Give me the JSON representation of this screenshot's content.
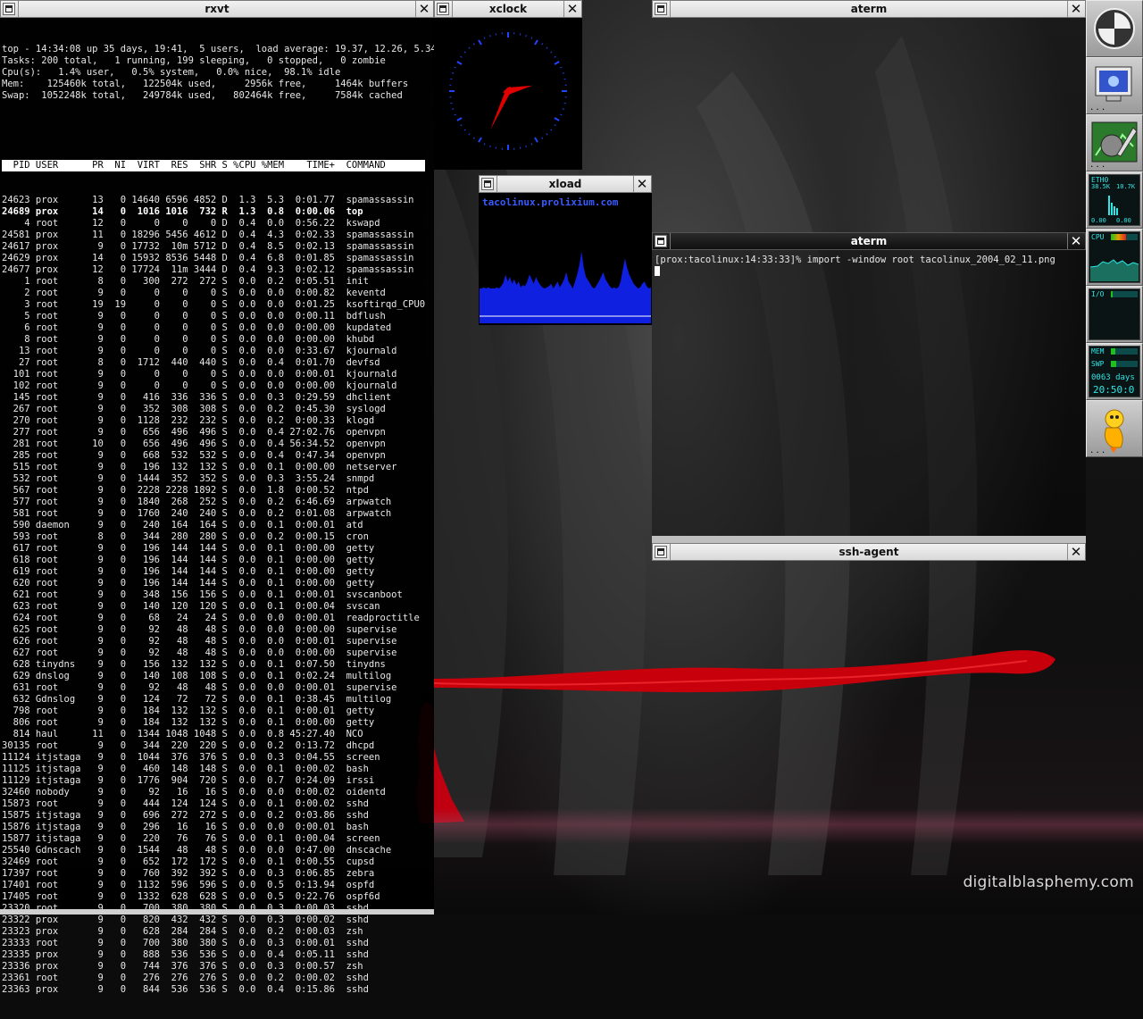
{
  "wallpaper": {
    "credit": "digitalblasphemy.com"
  },
  "rxvt": {
    "title": "rxvt",
    "summary": [
      "top - 14:34:08 up 35 days, 19:41,  5 users,  load average: 19.37, 12.26, 5.34",
      "Tasks: 200 total,   1 running, 199 sleeping,   0 stopped,   0 zombie",
      "Cpu(s):   1.4% user,   0.5% system,   0.0% nice,  98.1% idle",
      "Mem:    125460k total,   122504k used,     2956k free,     1464k buffers",
      "Swap:  1052248k total,   249784k used,   802464k free,     7584k cached"
    ],
    "columns": "  PID USER      PR  NI  VIRT  RES  SHR S %CPU %MEM    TIME+  COMMAND",
    "processes": [
      [
        "24623",
        "prox",
        "13",
        "0",
        "14640",
        "6596",
        "4852",
        "D",
        "1.3",
        "5.3",
        "0:01.77",
        "spamassassin"
      ],
      [
        "24689",
        "prox",
        "14",
        "0",
        "1016",
        "1016",
        "732",
        "R",
        "1.3",
        "0.8",
        "0:00.06",
        "top"
      ],
      [
        "4",
        "root",
        "12",
        "0",
        "0",
        "0",
        "0",
        "D",
        "0.4",
        "0.0",
        "0:56.22",
        "kswapd"
      ],
      [
        "24581",
        "prox",
        "11",
        "0",
        "18296",
        "5456",
        "4612",
        "D",
        "0.4",
        "4.3",
        "0:02.33",
        "spamassassin"
      ],
      [
        "24617",
        "prox",
        "9",
        "0",
        "17732",
        "10m",
        "5712",
        "D",
        "0.4",
        "8.5",
        "0:02.13",
        "spamassassin"
      ],
      [
        "24629",
        "prox",
        "14",
        "0",
        "15932",
        "8536",
        "5448",
        "D",
        "0.4",
        "6.8",
        "0:01.85",
        "spamassassin"
      ],
      [
        "24677",
        "prox",
        "12",
        "0",
        "17724",
        "11m",
        "3444",
        "D",
        "0.4",
        "9.3",
        "0:02.12",
        "spamassassin"
      ],
      [
        "1",
        "root",
        "8",
        "0",
        "300",
        "272",
        "272",
        "S",
        "0.0",
        "0.2",
        "0:05.51",
        "init"
      ],
      [
        "2",
        "root",
        "9",
        "0",
        "0",
        "0",
        "0",
        "S",
        "0.0",
        "0.0",
        "0:00.82",
        "keventd"
      ],
      [
        "3",
        "root",
        "19",
        "19",
        "0",
        "0",
        "0",
        "S",
        "0.0",
        "0.0",
        "0:01.25",
        "ksoftirqd_CPU0"
      ],
      [
        "5",
        "root",
        "9",
        "0",
        "0",
        "0",
        "0",
        "S",
        "0.0",
        "0.0",
        "0:00.11",
        "bdflush"
      ],
      [
        "6",
        "root",
        "9",
        "0",
        "0",
        "0",
        "0",
        "S",
        "0.0",
        "0.0",
        "0:00.00",
        "kupdated"
      ],
      [
        "8",
        "root",
        "9",
        "0",
        "0",
        "0",
        "0",
        "S",
        "0.0",
        "0.0",
        "0:00.00",
        "khubd"
      ],
      [
        "13",
        "root",
        "9",
        "0",
        "0",
        "0",
        "0",
        "S",
        "0.0",
        "0.0",
        "0:33.67",
        "kjournald"
      ],
      [
        "27",
        "root",
        "8",
        "0",
        "1712",
        "440",
        "440",
        "S",
        "0.0",
        "0.4",
        "0:01.70",
        "devfsd"
      ],
      [
        "101",
        "root",
        "9",
        "0",
        "0",
        "0",
        "0",
        "S",
        "0.0",
        "0.0",
        "0:00.01",
        "kjournald"
      ],
      [
        "102",
        "root",
        "9",
        "0",
        "0",
        "0",
        "0",
        "S",
        "0.0",
        "0.0",
        "0:00.00",
        "kjournald"
      ],
      [
        "145",
        "root",
        "9",
        "0",
        "416",
        "336",
        "336",
        "S",
        "0.0",
        "0.3",
        "0:29.59",
        "dhclient"
      ],
      [
        "267",
        "root",
        "9",
        "0",
        "352",
        "308",
        "308",
        "S",
        "0.0",
        "0.2",
        "0:45.30",
        "syslogd"
      ],
      [
        "270",
        "root",
        "9",
        "0",
        "1128",
        "232",
        "232",
        "S",
        "0.0",
        "0.2",
        "0:00.33",
        "klogd"
      ],
      [
        "277",
        "root",
        "9",
        "0",
        "656",
        "496",
        "496",
        "S",
        "0.0",
        "0.4",
        "27:02.76",
        "openvpn"
      ],
      [
        "281",
        "root",
        "10",
        "0",
        "656",
        "496",
        "496",
        "S",
        "0.0",
        "0.4",
        "56:34.52",
        "openvpn"
      ],
      [
        "285",
        "root",
        "9",
        "0",
        "668",
        "532",
        "532",
        "S",
        "0.0",
        "0.4",
        "0:47.34",
        "openvpn"
      ],
      [
        "515",
        "root",
        "9",
        "0",
        "196",
        "132",
        "132",
        "S",
        "0.0",
        "0.1",
        "0:00.00",
        "netserver"
      ],
      [
        "532",
        "root",
        "9",
        "0",
        "1444",
        "352",
        "352",
        "S",
        "0.0",
        "0.3",
        "3:55.24",
        "snmpd"
      ],
      [
        "567",
        "root",
        "9",
        "0",
        "2228",
        "2228",
        "1892",
        "S",
        "0.0",
        "1.8",
        "0:00.52",
        "ntpd"
      ],
      [
        "577",
        "root",
        "9",
        "0",
        "1840",
        "268",
        "252",
        "S",
        "0.0",
        "0.2",
        "6:46.69",
        "arpwatch"
      ],
      [
        "581",
        "root",
        "9",
        "0",
        "1760",
        "240",
        "240",
        "S",
        "0.0",
        "0.2",
        "0:01.08",
        "arpwatch"
      ],
      [
        "590",
        "daemon",
        "9",
        "0",
        "240",
        "164",
        "164",
        "S",
        "0.0",
        "0.1",
        "0:00.01",
        "atd"
      ],
      [
        "593",
        "root",
        "8",
        "0",
        "344",
        "280",
        "280",
        "S",
        "0.0",
        "0.2",
        "0:00.15",
        "cron"
      ],
      [
        "617",
        "root",
        "9",
        "0",
        "196",
        "144",
        "144",
        "S",
        "0.0",
        "0.1",
        "0:00.00",
        "getty"
      ],
      [
        "618",
        "root",
        "9",
        "0",
        "196",
        "144",
        "144",
        "S",
        "0.0",
        "0.1",
        "0:00.00",
        "getty"
      ],
      [
        "619",
        "root",
        "9",
        "0",
        "196",
        "144",
        "144",
        "S",
        "0.0",
        "0.1",
        "0:00.00",
        "getty"
      ],
      [
        "620",
        "root",
        "9",
        "0",
        "196",
        "144",
        "144",
        "S",
        "0.0",
        "0.1",
        "0:00.00",
        "getty"
      ],
      [
        "621",
        "root",
        "9",
        "0",
        "348",
        "156",
        "156",
        "S",
        "0.0",
        "0.1",
        "0:00.01",
        "svscanboot"
      ],
      [
        "623",
        "root",
        "9",
        "0",
        "140",
        "120",
        "120",
        "S",
        "0.0",
        "0.1",
        "0:00.04",
        "svscan"
      ],
      [
        "624",
        "root",
        "9",
        "0",
        "68",
        "24",
        "24",
        "S",
        "0.0",
        "0.0",
        "0:00.01",
        "readproctitle"
      ],
      [
        "625",
        "root",
        "9",
        "0",
        "92",
        "48",
        "48",
        "S",
        "0.0",
        "0.0",
        "0:00.00",
        "supervise"
      ],
      [
        "626",
        "root",
        "9",
        "0",
        "92",
        "48",
        "48",
        "S",
        "0.0",
        "0.0",
        "0:00.01",
        "supervise"
      ],
      [
        "627",
        "root",
        "9",
        "0",
        "92",
        "48",
        "48",
        "S",
        "0.0",
        "0.0",
        "0:00.00",
        "supervise"
      ],
      [
        "628",
        "tinydns",
        "9",
        "0",
        "156",
        "132",
        "132",
        "S",
        "0.0",
        "0.1",
        "0:07.50",
        "tinydns"
      ],
      [
        "629",
        "dnslog",
        "9",
        "0",
        "140",
        "108",
        "108",
        "S",
        "0.0",
        "0.1",
        "0:02.24",
        "multilog"
      ],
      [
        "631",
        "root",
        "9",
        "0",
        "92",
        "48",
        "48",
        "S",
        "0.0",
        "0.0",
        "0:00.01",
        "supervise"
      ],
      [
        "632",
        "Gdnslog",
        "9",
        "0",
        "124",
        "72",
        "72",
        "S",
        "0.0",
        "0.1",
        "0:38.45",
        "multilog"
      ],
      [
        "798",
        "root",
        "9",
        "0",
        "184",
        "132",
        "132",
        "S",
        "0.0",
        "0.1",
        "0:00.01",
        "getty"
      ],
      [
        "806",
        "root",
        "9",
        "0",
        "184",
        "132",
        "132",
        "S",
        "0.0",
        "0.1",
        "0:00.00",
        "getty"
      ],
      [
        "814",
        "haul",
        "11",
        "0",
        "1344",
        "1048",
        "1048",
        "S",
        "0.0",
        "0.8",
        "45:27.40",
        "NCO"
      ],
      [
        "30135",
        "root",
        "9",
        "0",
        "344",
        "220",
        "220",
        "S",
        "0.0",
        "0.2",
        "0:13.72",
        "dhcpd"
      ],
      [
        "11124",
        "itjstaga",
        "9",
        "0",
        "1044",
        "376",
        "376",
        "S",
        "0.0",
        "0.3",
        "0:04.55",
        "screen"
      ],
      [
        "11125",
        "itjstaga",
        "9",
        "0",
        "460",
        "148",
        "148",
        "S",
        "0.0",
        "0.1",
        "0:00.02",
        "bash"
      ],
      [
        "11129",
        "itjstaga",
        "9",
        "0",
        "1776",
        "904",
        "720",
        "S",
        "0.0",
        "0.7",
        "0:24.09",
        "irssi"
      ],
      [
        "32460",
        "nobody",
        "9",
        "0",
        "92",
        "16",
        "16",
        "S",
        "0.0",
        "0.0",
        "0:00.02",
        "oidentd"
      ],
      [
        "15873",
        "root",
        "9",
        "0",
        "444",
        "124",
        "124",
        "S",
        "0.0",
        "0.1",
        "0:00.02",
        "sshd"
      ],
      [
        "15875",
        "itjstaga",
        "9",
        "0",
        "696",
        "272",
        "272",
        "S",
        "0.0",
        "0.2",
        "0:03.86",
        "sshd"
      ],
      [
        "15876",
        "itjstaga",
        "9",
        "0",
        "296",
        "16",
        "16",
        "S",
        "0.0",
        "0.0",
        "0:00.01",
        "bash"
      ],
      [
        "15877",
        "itjstaga",
        "9",
        "0",
        "220",
        "76",
        "76",
        "S",
        "0.0",
        "0.1",
        "0:00.04",
        "screen"
      ],
      [
        "25540",
        "Gdnscach",
        "9",
        "0",
        "1544",
        "48",
        "48",
        "S",
        "0.0",
        "0.0",
        "0:47.00",
        "dnscache"
      ],
      [
        "32469",
        "root",
        "9",
        "0",
        "652",
        "172",
        "172",
        "S",
        "0.0",
        "0.1",
        "0:00.55",
        "cupsd"
      ],
      [
        "17397",
        "root",
        "9",
        "0",
        "760",
        "392",
        "392",
        "S",
        "0.0",
        "0.3",
        "0:06.85",
        "zebra"
      ],
      [
        "17401",
        "root",
        "9",
        "0",
        "1132",
        "596",
        "596",
        "S",
        "0.0",
        "0.5",
        "0:13.94",
        "ospfd"
      ],
      [
        "17405",
        "root",
        "9",
        "0",
        "1332",
        "628",
        "628",
        "S",
        "0.0",
        "0.5",
        "0:22.76",
        "ospf6d"
      ],
      [
        "23320",
        "root",
        "9",
        "0",
        "700",
        "380",
        "380",
        "S",
        "0.0",
        "0.3",
        "0:00.03",
        "sshd"
      ],
      [
        "23322",
        "prox",
        "9",
        "0",
        "820",
        "432",
        "432",
        "S",
        "0.0",
        "0.3",
        "0:00.02",
        "sshd"
      ],
      [
        "23323",
        "prox",
        "9",
        "0",
        "628",
        "284",
        "284",
        "S",
        "0.0",
        "0.2",
        "0:00.03",
        "zsh"
      ],
      [
        "23333",
        "root",
        "9",
        "0",
        "700",
        "380",
        "380",
        "S",
        "0.0",
        "0.3",
        "0:00.01",
        "sshd"
      ],
      [
        "23335",
        "prox",
        "9",
        "0",
        "888",
        "536",
        "536",
        "S",
        "0.0",
        "0.4",
        "0:05.11",
        "sshd"
      ],
      [
        "23336",
        "prox",
        "9",
        "0",
        "744",
        "376",
        "376",
        "S",
        "0.0",
        "0.3",
        "0:00.57",
        "zsh"
      ],
      [
        "23361",
        "root",
        "9",
        "0",
        "276",
        "276",
        "276",
        "S",
        "0.0",
        "0.2",
        "0:00.02",
        "sshd"
      ],
      [
        "23363",
        "prox",
        "9",
        "0",
        "844",
        "536",
        "536",
        "S",
        "0.0",
        "0.4",
        "0:15.86",
        "sshd"
      ]
    ]
  },
  "xclock": {
    "title": "xclock",
    "hour_hand": 2.57,
    "minute_hand": 34.1,
    "tick_color": "#2244ff",
    "hand_color": "#e00000"
  },
  "xload": {
    "title": "xload",
    "host": "tacolinux.prolixium.com",
    "history": [
      0.3,
      0.3,
      0.31,
      0.3,
      0.31,
      0.3,
      0.3,
      0.3,
      0.31,
      0.3,
      0.32,
      0.35,
      0.42,
      0.36,
      0.4,
      0.34,
      0.38,
      0.33,
      0.36,
      0.31,
      0.33,
      0.32,
      0.36,
      0.42,
      0.38,
      0.34,
      0.4,
      0.36,
      0.33,
      0.31,
      0.3,
      0.31,
      0.32,
      0.34,
      0.3,
      0.33,
      0.36,
      0.31,
      0.34,
      0.38,
      0.44,
      0.36,
      0.33,
      0.3,
      0.36,
      0.42,
      0.5,
      0.62,
      0.48,
      0.4,
      0.37,
      0.34,
      0.31,
      0.3,
      0.33,
      0.36,
      0.4,
      0.44,
      0.38,
      0.35,
      0.32,
      0.3,
      0.31,
      0.3,
      0.31,
      0.36,
      0.46,
      0.56,
      0.48,
      0.42,
      0.38,
      0.34,
      0.32,
      0.3,
      0.31,
      0.34,
      0.36,
      0.32,
      0.3,
      0.31
    ],
    "fill_color": "#1020e0",
    "line_color": "#ffffff"
  },
  "aterm_top": {
    "title": "aterm"
  },
  "aterm_main": {
    "title": "aterm",
    "prompt": "[prox:tacolinux:14:33:33]% import -window root tacolinux_2004_02_11.png"
  },
  "ssh_agent": {
    "title": "ssh-agent"
  },
  "dock": {
    "apps": [
      {
        "name": "window-maker"
      },
      {
        "name": "monitor"
      },
      {
        "name": "paint"
      },
      {
        "name": "net-monitor",
        "label": "ETH0",
        "rx": "38.5K",
        "tx": "10.7K",
        "rx_peak": "0.00",
        "tx_peak": "0.00"
      },
      {
        "name": "cpu-monitor",
        "label": "CPU",
        "usage": 0.55
      },
      {
        "name": "io-monitor",
        "label": "I/O",
        "usage": 0.05
      },
      {
        "name": "mem-monitor",
        "mem_label": "MEM",
        "swap_label": "SWP",
        "mem_usage": 0.15,
        "swap_usage": 0.2,
        "uptime": "0063 days",
        "clock": "20:50:0"
      },
      {
        "name": "pidgin"
      }
    ]
  }
}
